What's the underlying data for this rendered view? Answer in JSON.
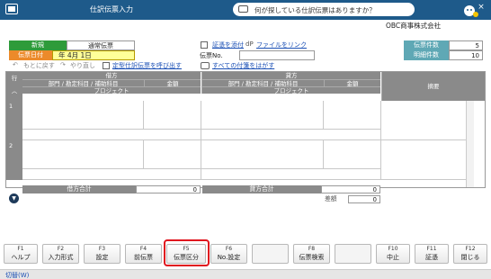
{
  "window": {
    "title": "仕訳伝票入力",
    "search_placeholder": "何が探している仕訳伝票はありますか？",
    "close_label": "×"
  },
  "company": "OBC商事株式会社",
  "header": {
    "mode_label": "新規",
    "voucher_type": "通常伝票",
    "date_label": "伝票日付",
    "date_value": "年  4月  1日",
    "voucher_no_label": "伝票No.",
    "voucher_no_value": "",
    "attach_label": "証憑を添付",
    "link_label": "ファイルをリンク",
    "undo_label": "もとに戻す",
    "redo_label": "やり直し",
    "template_label": "定型仕訳伝票を呼び出す",
    "remove_tags_label": "すべての付箋をはがす"
  },
  "counts": {
    "voucher_count_label": "伝票件数",
    "voucher_count": "5",
    "detail_count_label": "明細件数",
    "detail_count": "10"
  },
  "grid": {
    "row_header": "行",
    "debit_title": "借方",
    "credit_title": "貸方",
    "dept_account_label": "部門 / 勘定科目 / 補助科目",
    "amount_label": "金額",
    "project_label": "プロジェクト",
    "summary_label": "摘要",
    "rows": [
      "1",
      "2"
    ]
  },
  "totals": {
    "debit_total_label": "借方合計",
    "debit_total": "0",
    "credit_total_label": "貸方合計",
    "credit_total": "0",
    "diff_label": "差額",
    "diff_value": "0"
  },
  "fkeys": [
    {
      "key": "F1",
      "label": "ヘルプ"
    },
    {
      "key": "F2",
      "label": "入力形式"
    },
    {
      "key": "F3",
      "label": "設定"
    },
    {
      "key": "F4",
      "label": "前伝票"
    },
    {
      "key": "F5",
      "label": "伝票区分"
    },
    {
      "key": "F6",
      "label": "No.設定"
    },
    {
      "key": "",
      "label": ""
    },
    {
      "key": "F8",
      "label": "伝票検索"
    },
    {
      "key": "",
      "label": ""
    },
    {
      "key": "F10",
      "label": "中止"
    },
    {
      "key": "F11",
      "label": "証憑"
    },
    {
      "key": "F12",
      "label": "閉じる"
    }
  ],
  "status": {
    "switch_label": "切替(W)"
  },
  "colors": {
    "titlebar": "#1e5a8a",
    "new_label": "#2e9b3a",
    "date_label": "#ec8a2a",
    "count_label": "#5fa8b5",
    "highlight": "#e0141e"
  }
}
